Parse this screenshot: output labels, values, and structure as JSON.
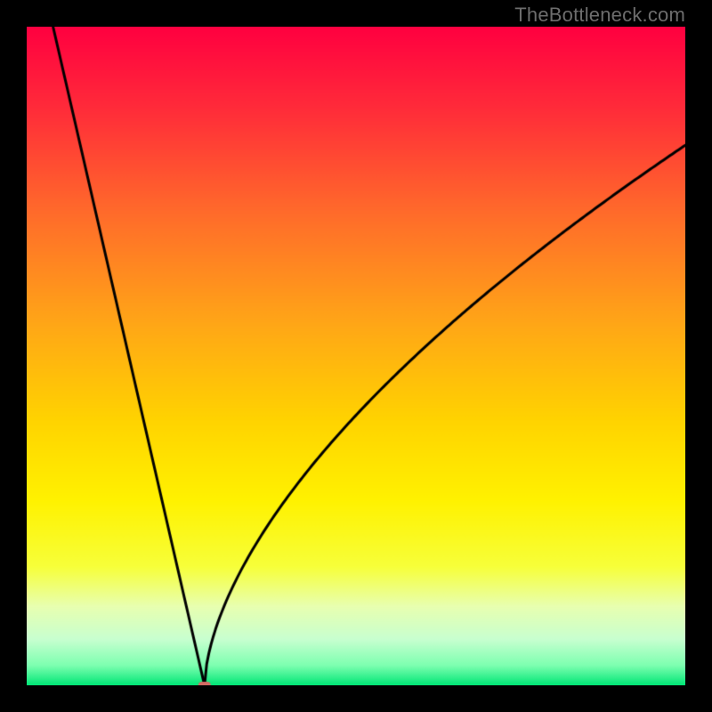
{
  "watermark": "TheBottleneck.com",
  "colors": {
    "frame": "#000000",
    "watermark": "#6d6d6d",
    "curve": "#000000",
    "marker_fill": "#d36a63",
    "gradient_stops": [
      {
        "pos": 0.0,
        "color": "#ff0040"
      },
      {
        "pos": 0.12,
        "color": "#ff2a3a"
      },
      {
        "pos": 0.28,
        "color": "#ff6a2b"
      },
      {
        "pos": 0.45,
        "color": "#ffa617"
      },
      {
        "pos": 0.6,
        "color": "#ffd400"
      },
      {
        "pos": 0.72,
        "color": "#fff200"
      },
      {
        "pos": 0.82,
        "color": "#f7ff3a"
      },
      {
        "pos": 0.88,
        "color": "#e8ffb0"
      },
      {
        "pos": 0.93,
        "color": "#c8ffd0"
      },
      {
        "pos": 0.97,
        "color": "#7dffb0"
      },
      {
        "pos": 1.0,
        "color": "#00e676"
      }
    ]
  },
  "chart_data": {
    "type": "line",
    "title": "",
    "xlabel": "",
    "ylabel": "",
    "xlim": [
      0,
      100
    ],
    "ylim": [
      0,
      100
    ],
    "x_min_marker": 27,
    "left_branch_start": {
      "x": 4,
      "y": 100
    },
    "right_branch_end": {
      "x": 100,
      "y": 82
    },
    "right_branch_shape_k": 0.6,
    "series": [
      {
        "name": "bottleneck-curve",
        "x": [
          4,
          10,
          16,
          22,
          25,
          27,
          29,
          33,
          40,
          50,
          60,
          70,
          80,
          90,
          100
        ],
        "values": [
          100,
          74,
          48,
          22,
          9,
          0,
          7,
          20,
          38,
          54,
          64,
          71,
          76,
          79,
          82
        ]
      }
    ],
    "legend": [],
    "grid": false
  }
}
